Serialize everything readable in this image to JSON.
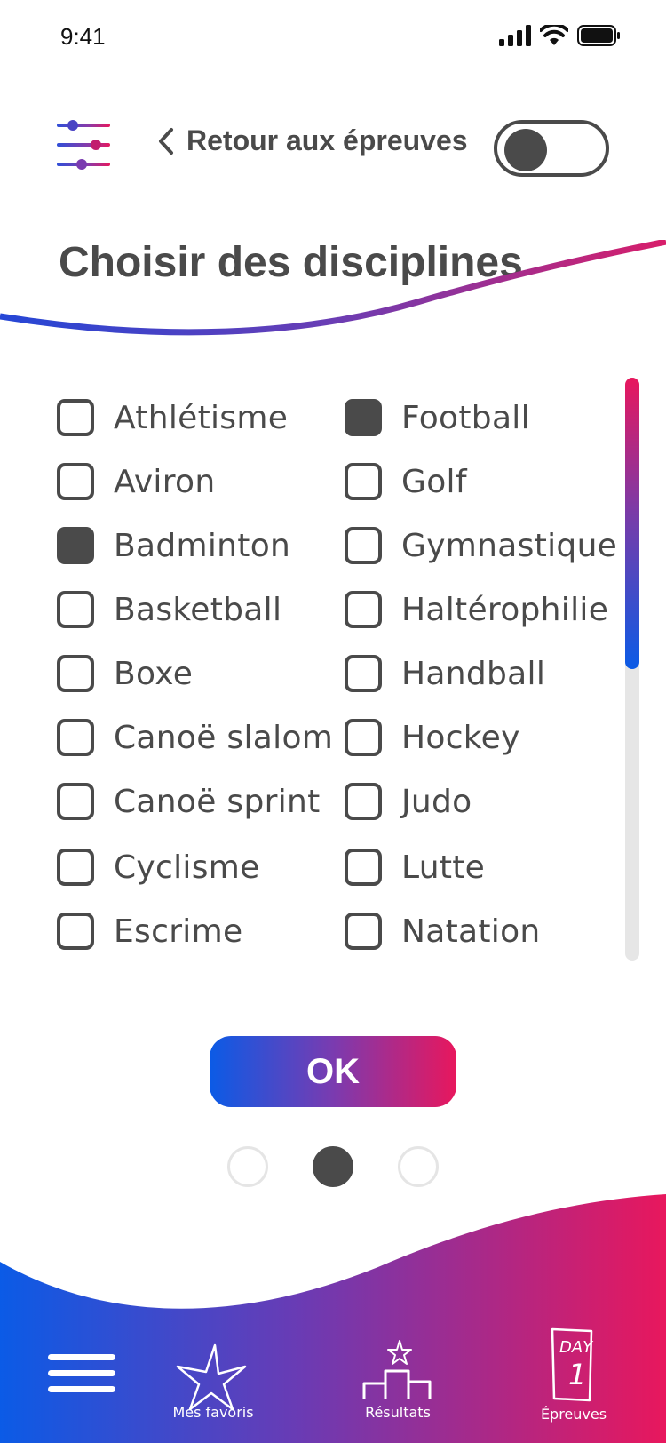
{
  "status": {
    "time": "9:41"
  },
  "header": {
    "back_label": "Retour aux épreuves",
    "toggle_on": false
  },
  "title": "Choisir des disciplines",
  "disciplines": {
    "left": [
      {
        "label": "Athlétisme",
        "checked": false
      },
      {
        "label": "Aviron",
        "checked": false
      },
      {
        "label": "Badminton",
        "checked": true
      },
      {
        "label": "Basketball",
        "checked": false
      },
      {
        "label": "Boxe",
        "checked": false
      },
      {
        "label": "Canoë slalom",
        "checked": false
      },
      {
        "label": "Canoë sprint",
        "checked": false
      },
      {
        "label": "Cyclisme",
        "checked": false
      },
      {
        "label": "Escrime",
        "checked": false
      }
    ],
    "right": [
      {
        "label": "Football",
        "checked": true
      },
      {
        "label": "Golf",
        "checked": false
      },
      {
        "label": "Gymnastique",
        "checked": false
      },
      {
        "label": "Haltérophilie",
        "checked": false
      },
      {
        "label": "Handball",
        "checked": false
      },
      {
        "label": "Hockey",
        "checked": false
      },
      {
        "label": "Judo",
        "checked": false
      },
      {
        "label": "Lutte",
        "checked": false
      },
      {
        "label": "Natation",
        "checked": false
      }
    ]
  },
  "scroll_position": 0.0,
  "ok_label": "OK",
  "pager": {
    "count": 3,
    "active_index": 1
  },
  "nav": {
    "menu_icon": "hamburger-icon",
    "items": [
      {
        "label": "Mes favoris",
        "icon": "star-icon"
      },
      {
        "label": "Résultats",
        "icon": "podium-icon"
      },
      {
        "label": "Épreuves",
        "icon": "calendar-day-icon",
        "icon_text_1": "DAY",
        "icon_text_2": "1"
      }
    ]
  },
  "colors": {
    "primary_text": "#4a4a4a",
    "gradient_blue": "#0b5be6",
    "gradient_purple": "#7a3bb0",
    "gradient_pink": "#e8175d"
  }
}
